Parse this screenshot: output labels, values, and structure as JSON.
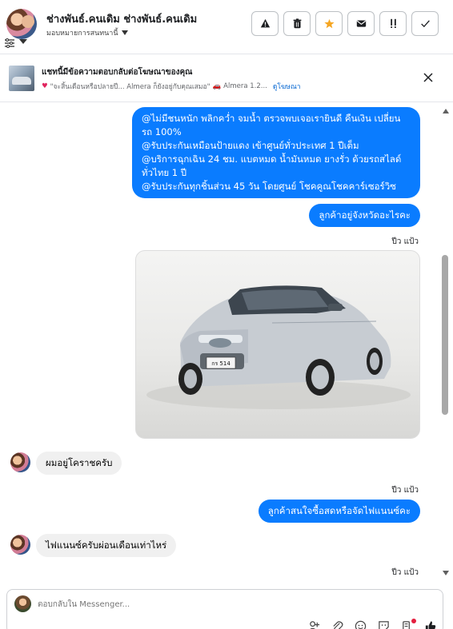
{
  "header": {
    "name": "ช่างพันธ์.คนเดิม ช่างพันธ์.คนเดิม",
    "assign_label": "มอบหมายการสนทนานี้",
    "actions": [
      {
        "icon": "warning-icon"
      },
      {
        "icon": "trash-icon"
      },
      {
        "icon": "star-icon"
      },
      {
        "icon": "mail-icon"
      },
      {
        "icon": "important-icon"
      },
      {
        "icon": "check-icon"
      }
    ],
    "star_color": "#f5a623"
  },
  "ad": {
    "title": "แชทนี้มีข้อความตอบกลับต่อโฆษณาของคุณ",
    "snippet": "\"จะสิ้นเดือนหรือปลายปี... Almera ก็ยังอยู่กับคุณเสมอ\"",
    "snippet2": "Almera 1.2...",
    "link_label": "ดูโฆษณา"
  },
  "messages": {
    "out1_lines": [
      "@ไม่มีชนหนัก พลิกคว่ำ จมน้ำ ตรวจพบเจอเรายินดี คืนเงิน เปลี่ยนรถ 100%",
      "@รับประกันเหมือนป้ายแดง เข้าศูนย์ทั่วประเทศ 1 ปีเต็ม",
      "@บริการฉุกเฉิน 24 ชม. แบตหมด น้ำมันหมด ยางรั่ว ด้วยรถสไลด์ทั่วไทย 1 ปี",
      "@รับประกันทุกชิ้นส่วน 45 วัน โดยศูนย์ โชคคูณโชคคาร์เซอร์วิซ"
    ],
    "out2": "ลูกค้าอยู่จังหวัดอะไรคะ",
    "seen1": "ปีว แป้ว",
    "photo_plate": "กร 514",
    "in1": "ผมอยู่โคราชครับ",
    "seen2": "ปีว แป้ว",
    "out3": "ลูกค้าสนใจซื้อสดหรือจัดไฟแนนซ์คะ",
    "in2": "ไฟแนนซ์ครับผ่อนเดือนเท่าไหร่",
    "seen3": "ปีว แป้ว"
  },
  "composer": {
    "placeholder": "ตอบกลับใน Messenger..."
  },
  "colors": {
    "outgoing_bubble": "#0a7cff",
    "incoming_bubble": "#f0f0f0",
    "link": "#0064d1"
  }
}
